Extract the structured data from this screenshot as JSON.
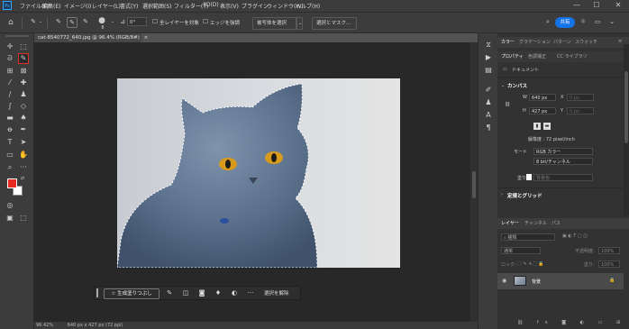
{
  "app": {
    "logo": "Ps"
  },
  "menu": [
    "ファイル(F)",
    "編集(E)",
    "イメージ(I)",
    "レイヤー(L)",
    "書式(Y)",
    "選択範囲(S)",
    "フィルター(T)",
    "3D(D)",
    "表示(V)",
    "プラグイン",
    "ウィンドウ(W)",
    "ヘルプ(H)"
  ],
  "window_controls": {
    "minimize": "—",
    "maximize": "☐",
    "close": "✕"
  },
  "options": {
    "brush_size": "8",
    "angle_value": "0°",
    "sample_all_label": "全レイヤーを対象",
    "edge_label": "エッジを強調",
    "select_subject_label": "被写体を選択",
    "select_mask_label": "選択とマスク...",
    "share_label": "共有"
  },
  "document": {
    "tab_title": "cat-8540772_640.jpg @ 96.4% (RGB/8#)",
    "tab_close": "×",
    "status_zoom": "96.42%",
    "status_info": "640 px x 427 px (72 ppi)"
  },
  "taskbar": {
    "generative_fill_label": "生成塗りつぶし",
    "deselect_label": "選択を解除",
    "more": "···"
  },
  "panels": {
    "top_tabs": [
      "カラー",
      "グラデーション",
      "パターン",
      "スウォッチ"
    ],
    "prop_tabs": [
      "プロパティ",
      "色調補正",
      "CC ライブラリ"
    ],
    "doc_label": "ドキュメント",
    "canvas_header": "カンバス",
    "w_label": "W",
    "w_value": "640 px",
    "x_label": "X",
    "x_value": "0 px",
    "h_label": "H",
    "h_value": "427 px",
    "y_label": "Y",
    "y_value": "0 px",
    "resolution": "解像度 : 72 pixel/inch",
    "mode_label": "モード",
    "mode_value": "RGB カラー",
    "bit_value": "8 bit/チャンネル",
    "fill_label": "塗り",
    "fill_value": "背景色",
    "ruler_header": "定規とグリッド",
    "layer_tabs": [
      "レイヤー",
      "チャンネル",
      "パス"
    ],
    "search_placeholder": "種類",
    "blend_mode": "通常",
    "opacity_label": "不透明度:",
    "opacity_value": "100%",
    "lock_label": "ロック:",
    "fill2_label": "塗り:",
    "fill2_value": "100%",
    "layer_name": "背景"
  },
  "colors": {
    "accent": "#1473e6",
    "foreground": "#e8291f",
    "background": "#ffffff"
  }
}
